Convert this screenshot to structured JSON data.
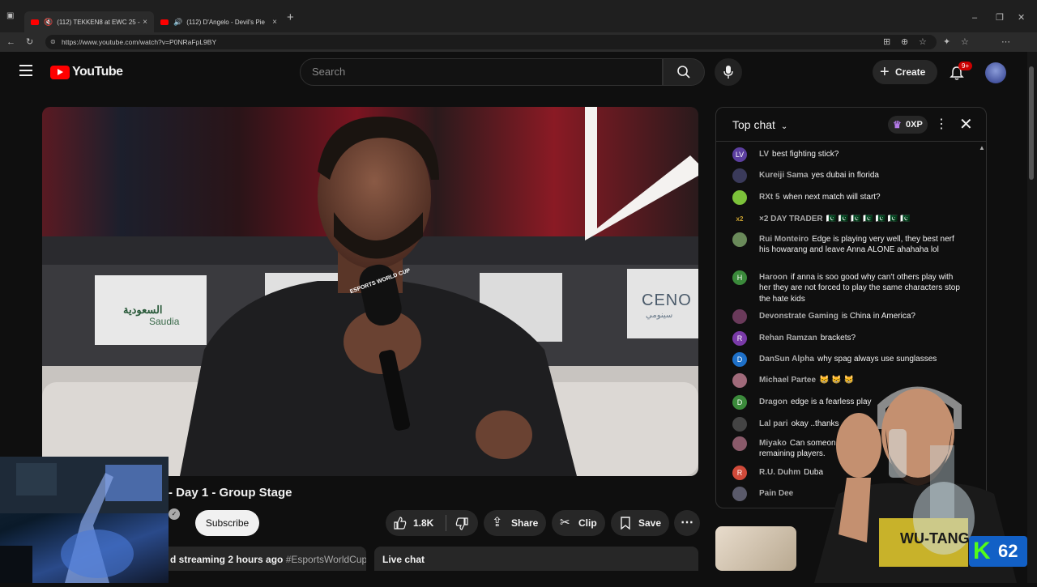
{
  "browser": {
    "tabs": [
      {
        "title": "(112) TEKKEN8 at EWC 25 -",
        "active": true
      },
      {
        "title": "(112) D'Angelo - Devil's Pie",
        "active": false
      }
    ],
    "url": "https://www.youtube.com/watch?v=P0NRaFpL9BY"
  },
  "header": {
    "logo_text": "YouTube",
    "search_placeholder": "Search",
    "create_label": "Create",
    "notif_count": "9+"
  },
  "video": {
    "title": "- Day 1 - Group Stage",
    "subscribe_label": "Subscribe",
    "like_count": "1.8K",
    "share_label": "Share",
    "clip_label": "Clip",
    "save_label": "Save",
    "meta_text": "d streaming 2 hours ago",
    "hashtag": "#EsportsWorldCup",
    "live_chat_label": "Live chat",
    "mic_brand": "ESPORTS WORLD CUP",
    "sponsor_left": "Saudia",
    "sponsor_left_ar": "السعودية",
    "sponsor_right": "CENO",
    "sponsor_right_ar": "سينومي"
  },
  "chat": {
    "title": "Top chat",
    "xp_label": "0XP",
    "messages": [
      {
        "author": "LV",
        "initials": "LV",
        "color": "#5c3fa0",
        "text": "best fighting stick?"
      },
      {
        "author": "Kureiji Sama",
        "initials": "",
        "color": "#3a3a5a",
        "text": "yes dubai in florida"
      },
      {
        "author": "RXt 5",
        "initials": "",
        "color": "#7cc23a",
        "text": "when next match will start?"
      },
      {
        "author": "×2 DAY TRADER",
        "initials": "",
        "color": "#c9a030",
        "text": "🇵🇰 🇵🇰 🇵🇰 🇵🇰 🇵🇰 🇵🇰 🇵🇰"
      },
      {
        "author": "Rui Monteiro",
        "initials": "",
        "color": "#6a8a5a",
        "text": "Edge is playing very well, they best nerf his howarang and leave Anna ALONE ahahaha lol"
      },
      {
        "author": "Haroon",
        "initials": "H",
        "color": "#3b8a3b",
        "text": "if anna is soo good why can't others play with her they are not forced to play the same characters stop the hate kids"
      },
      {
        "author": "Devonstrate Gaming",
        "initials": "",
        "color": "#6a3a5a",
        "text": "is China in America?"
      },
      {
        "author": "Rehan Ramzan",
        "initials": "R",
        "color": "#7a3aa8",
        "text": "brackets?"
      },
      {
        "author": "DanSun Alpha",
        "initials": "D",
        "color": "#1e70c8",
        "text": "why spag always use sunglasses"
      },
      {
        "author": "Michael Partee",
        "initials": "",
        "color": "#a06a7a",
        "text": "😸 😸 😸"
      },
      {
        "author": "Dragon",
        "initials": "D",
        "color": "#3b8a3b",
        "text": "edge is a fearless play"
      },
      {
        "author": "Lal pari",
        "initials": "",
        "color": "#444444",
        "text": "okay ..thanks"
      },
      {
        "author": "Miyako",
        "initials": "",
        "color": "#8a5a6a",
        "text": "Can someon remaining players."
      },
      {
        "author": "R.U. Duhm",
        "initials": "R",
        "color": "#d04a3a",
        "text": "Duba"
      },
      {
        "author": "Pain Dee",
        "initials": "",
        "color": "#5a5a6a",
        "text": ""
      }
    ]
  },
  "overlay": {
    "badge_letter": "K",
    "badge_number": "62",
    "shirt_text": "WU-TANG"
  }
}
